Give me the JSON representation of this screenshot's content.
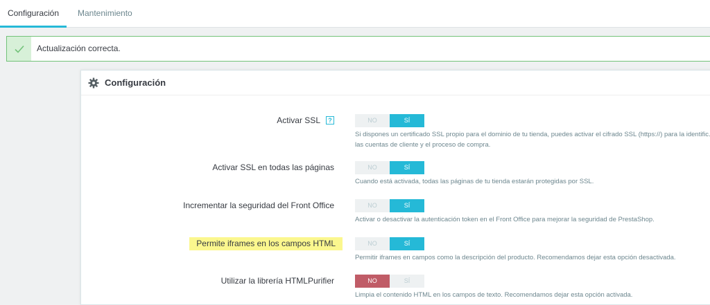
{
  "tabs": [
    {
      "label": "Configuración",
      "active": true
    },
    {
      "label": "Mantenimiento",
      "active": false
    }
  ],
  "alert": {
    "text": "Actualización correcta.",
    "icon": "check-icon"
  },
  "panel": {
    "title": "Configuración",
    "icon": "gear-icon",
    "rows": [
      {
        "label": "Activar SSL",
        "has_help": true,
        "help_text": "?",
        "no_label": "NO",
        "yes_label": "SÍ",
        "value": "yes",
        "description": "Si dispones un certificado SSL propio para el dominio de tu tienda, puedes activar el cifrado SSL (https://) para la identific... las cuentas de cliente y el proceso de compra."
      },
      {
        "label": "Activar SSL en todas las páginas",
        "has_help": false,
        "no_label": "NO",
        "yes_label": "SÍ",
        "value": "yes",
        "description": "Cuando está activada, todas las páginas de tu tienda estarán protegidas por SSL."
      },
      {
        "label": "Incrementar la seguridad del Front Office",
        "has_help": false,
        "no_label": "NO",
        "yes_label": "SÍ",
        "value": "yes",
        "description": "Activar o desactivar la autenticación token en el Front Office para mejorar la seguridad de PrestaShop."
      },
      {
        "label": "Permite iframes en los campos HTML",
        "has_help": false,
        "highlighted": true,
        "no_label": "NO",
        "yes_label": "SÍ",
        "value": "yes",
        "description": "Permitir iframes en campos como la descripción del producto. Recomendamos dejar esta opción desactivada."
      },
      {
        "label": "Utilizar la librería HTMLPurifier",
        "has_help": false,
        "no_label": "NO",
        "yes_label": "SÍ",
        "value": "no",
        "description": "Limpia el contenido HTML en los campos de texto. Recomendamos dejar esta opción activada."
      }
    ]
  },
  "colors": {
    "accent": "#25b9d7",
    "danger": "#c05c67",
    "success_border": "#72c279",
    "highlight": "#fbf78e"
  }
}
